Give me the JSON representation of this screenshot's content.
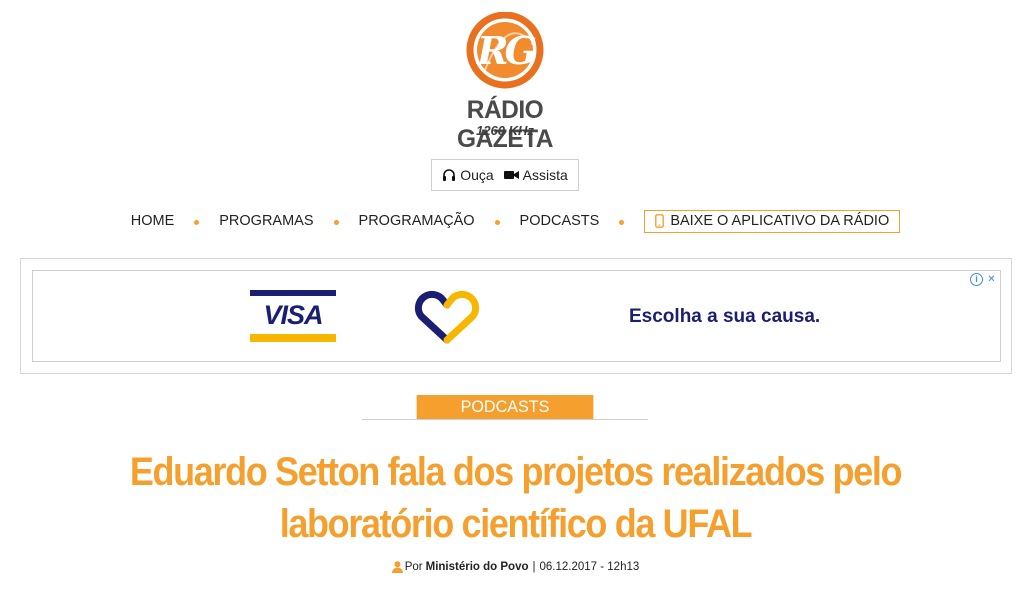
{
  "brand": {
    "logo_letters": "RG",
    "name": "RÁDIO GAZETA",
    "frequency": "1260 KHz",
    "accent_color": "#f5a02e"
  },
  "media": {
    "listen_icon": "headphones-icon",
    "listen_label": "Ouça",
    "watch_icon": "video-camera-icon",
    "watch_label": "Assista"
  },
  "nav": {
    "items": [
      {
        "label": "HOME"
      },
      {
        "label": "PROGRAMAS"
      },
      {
        "label": "PROGRAMAÇÃO"
      },
      {
        "label": "PODCASTS"
      }
    ],
    "app_icon": "phone-icon",
    "app_label": "BAIXE O APLICATIVO DA RÁDIO"
  },
  "ad": {
    "brand": "VISA",
    "tagline": "Escolha a sua causa.",
    "info_icon": "ad-info-icon",
    "close_icon": "ad-close-icon",
    "info_glyph": "i",
    "close_glyph": "✕",
    "brand_color": "#1a1f71",
    "brand_accent": "#f7b600"
  },
  "article": {
    "category": "PODCASTS",
    "title": "Eduardo Setton fala dos projetos realizados pelo laboratório científico da UFAL",
    "byline_prefix": "Por",
    "author": "Ministério do Povo",
    "separator": "|",
    "date": "06.12.2017 - 12h13",
    "author_icon": "user-icon"
  }
}
